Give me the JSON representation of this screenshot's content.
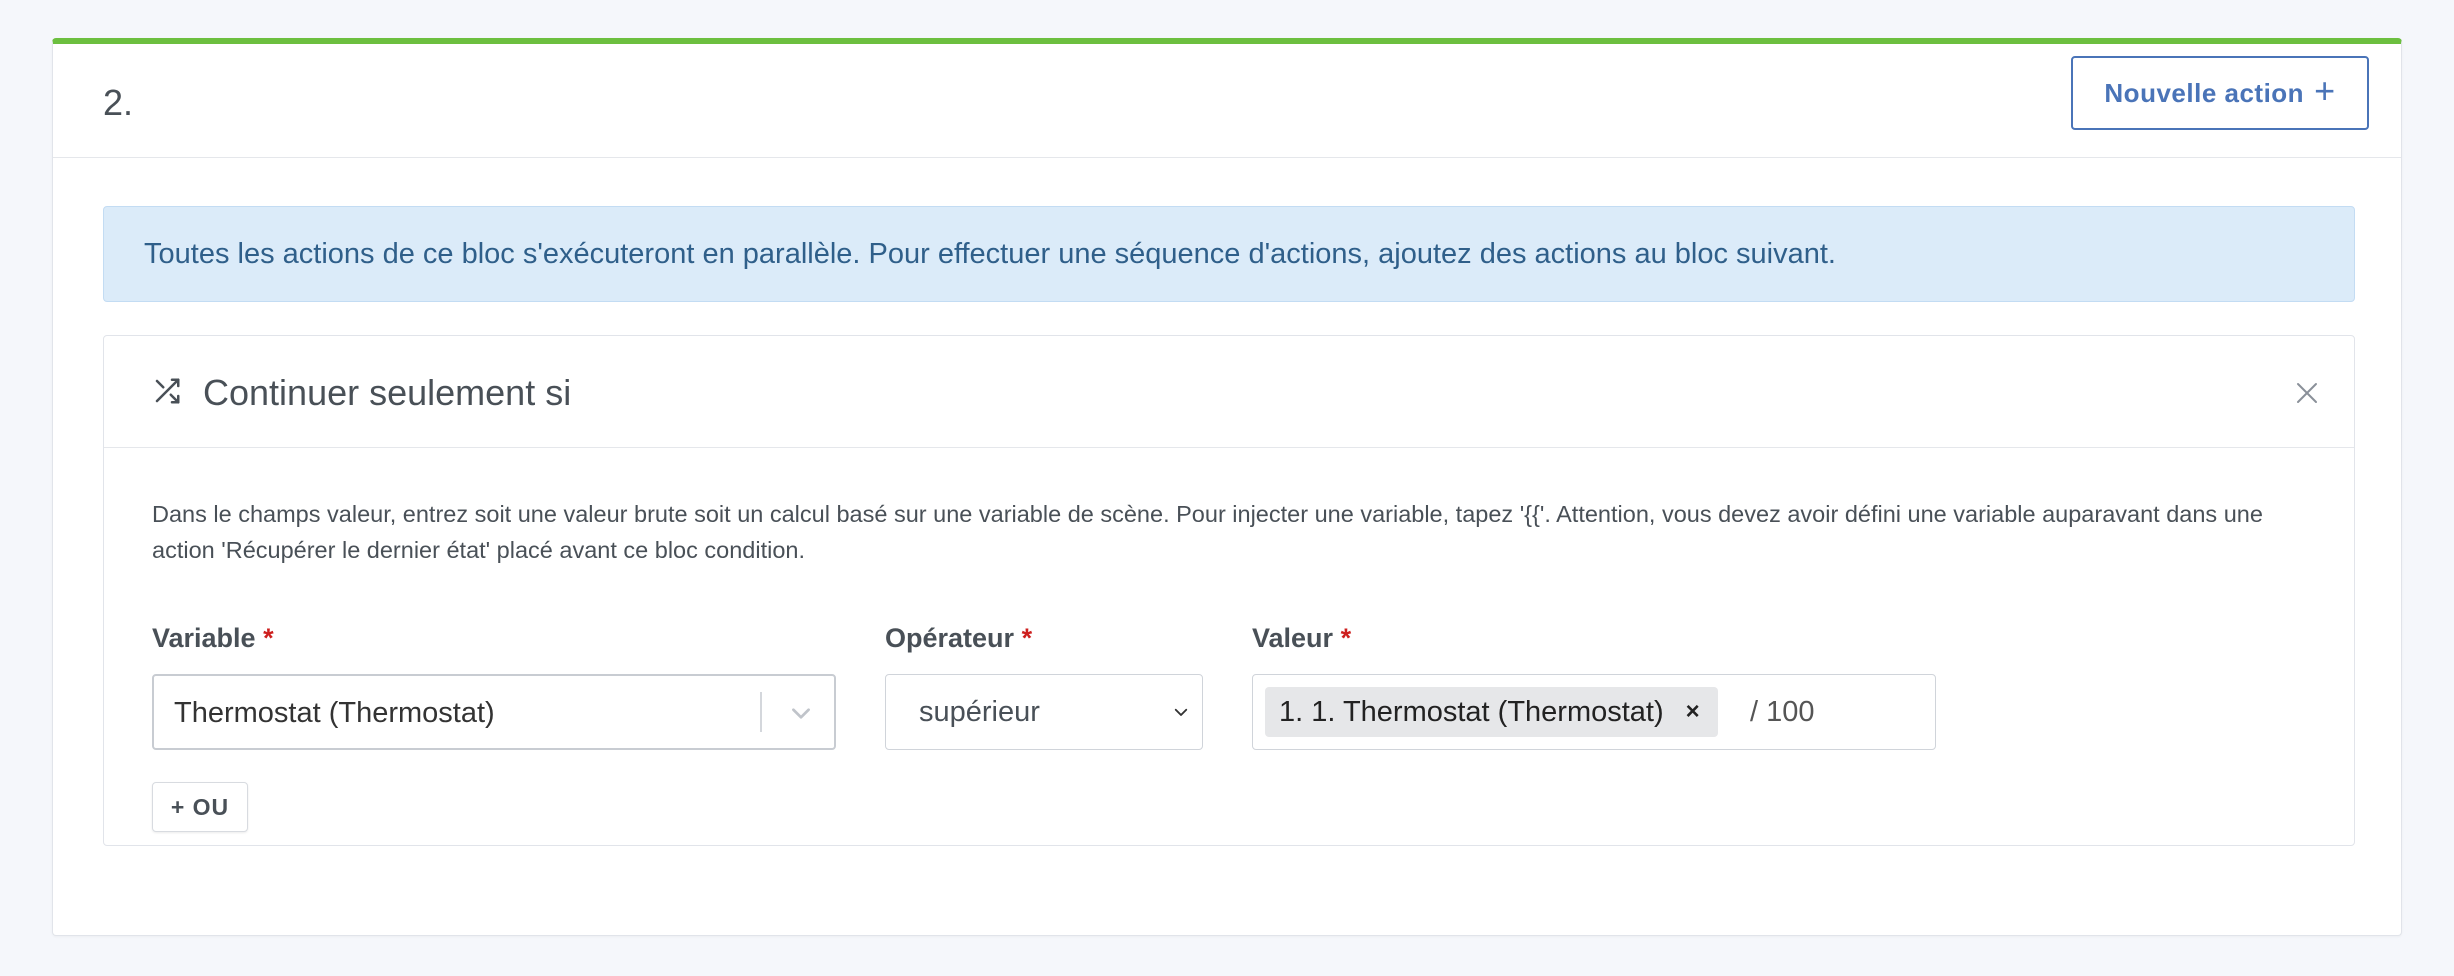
{
  "block": {
    "number": "2.",
    "new_action_label": "Nouvelle action",
    "new_action_icon": "plus-icon"
  },
  "info_alert": {
    "text": "Toutes les actions de ce bloc s'exécuteront en parallèle. Pour effectuer une séquence d'actions, ajoutez des actions au bloc suivant."
  },
  "condition": {
    "title": "Continuer seulement si",
    "title_icon": "shuffle-icon",
    "close_icon": "close-icon",
    "help_text": "Dans le champs valeur, entrez soit une valeur brute soit un calcul basé sur une variable de scène. Pour injecter une variable, tapez '{{'. Attention, vous devez avoir défini une variable auparavant dans une action 'Récupérer le dernier état' placé avant ce bloc condition.",
    "variable": {
      "label": "Variable",
      "required_mark": "*",
      "value": "Thermostat (Thermostat)"
    },
    "operator": {
      "label": "Opérateur",
      "required_mark": "*",
      "value": "supérieur"
    },
    "valeur": {
      "label": "Valeur",
      "required_mark": "*",
      "tag_text": "1. 1. Thermostat (Thermostat)",
      "tag_remove": "×",
      "suffix": "/ 100"
    },
    "or_button_label": "+ OU"
  },
  "colors": {
    "accent_green": "#6cbf3f",
    "primary_blue": "#4a74b8",
    "info_bg": "#dbebf9",
    "required_red": "#cd201f"
  }
}
